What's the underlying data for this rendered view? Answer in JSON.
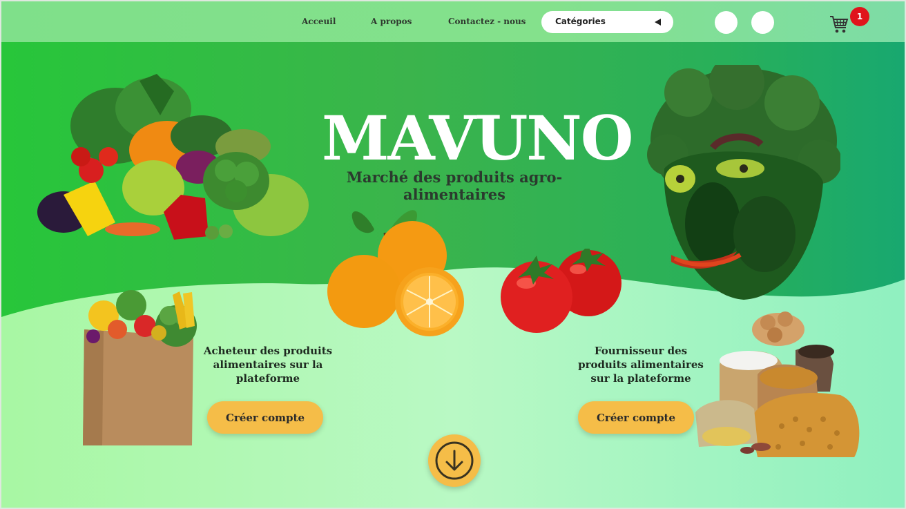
{
  "nav": {
    "links": [
      "Acceuil",
      "A propos",
      "Contactez - nous"
    ],
    "categories_label": "Catégories",
    "cart_count": "1"
  },
  "hero": {
    "title": "MAVUNO",
    "subtitle": "Marché des produits agro-alimentaires"
  },
  "cards": [
    {
      "text": "Acheteur des produits alimentaires sur la plateforme",
      "button": "Créer compte"
    },
    {
      "text": "Fournisseur des produits alimentaires sur la plateforme",
      "button": "Créer compte"
    }
  ],
  "colors": {
    "hero_green": "#3bb44c",
    "wave_mint": "#b5f8c5",
    "button_yellow": "#f5bd48",
    "badge_red": "#e0141b"
  },
  "icons": [
    "cart-icon",
    "arrow-down-icon",
    "chevron-left-icon"
  ]
}
